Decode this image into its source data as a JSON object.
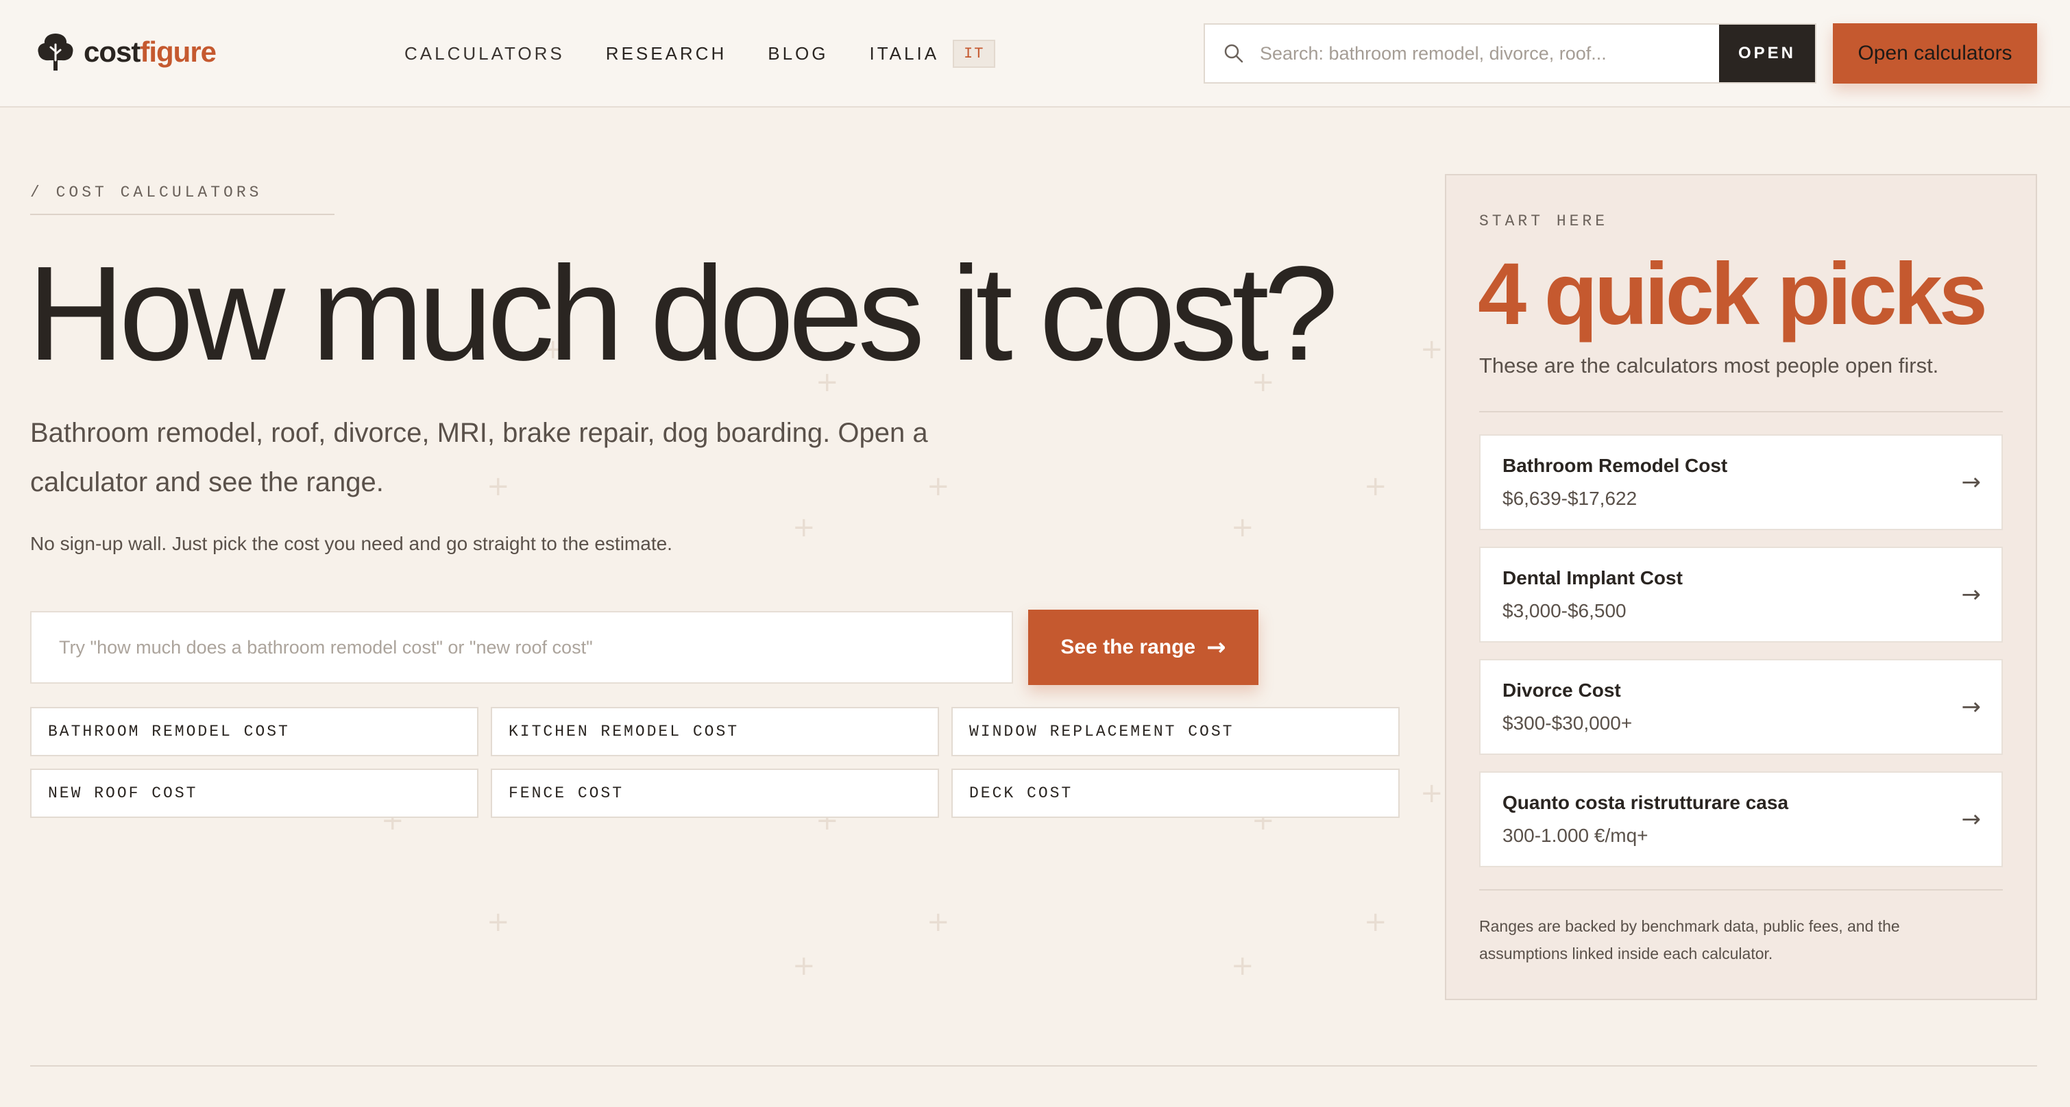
{
  "header": {
    "logo_cost": "cost",
    "logo_figure": "figure",
    "nav": [
      "CALCULATORS",
      "RESEARCH",
      "BLOG",
      "ITALIA"
    ],
    "nav_badge": "IT",
    "search_placeholder": "Search: bathroom remodel, divorce, roof...",
    "open_label": "OPEN",
    "open_calculators_label": "Open calculators"
  },
  "hero": {
    "breadcrumb": "/ COST CALCULATORS",
    "title": "How much does it cost?",
    "subtitle": "Bathroom remodel, roof, divorce, MRI, brake repair, dog boarding. Open a calculator and see the range.",
    "note": "No sign-up wall. Just pick the cost you need and go straight to the estimate.",
    "search_placeholder": "Try \"how much does a bathroom remodel cost\" or \"new roof cost\"",
    "range_button": "See the range",
    "chips": [
      "BATHROOM REMODEL COST",
      "KITCHEN REMODEL COST",
      "WINDOW REPLACEMENT COST",
      "NEW ROOF COST",
      "FENCE COST",
      "DECK COST"
    ]
  },
  "panel": {
    "label": "START HERE",
    "title": "4 quick picks",
    "description": "These are the calculators most people open first.",
    "picks": [
      {
        "name": "Bathroom Remodel Cost",
        "range": "$6,639-$17,622"
      },
      {
        "name": "Dental Implant Cost",
        "range": "$3,000-$6,500"
      },
      {
        "name": "Divorce Cost",
        "range": "$300-$30,000+"
      },
      {
        "name": "Quanto costa ristrutturare casa",
        "range": "300-1.000 €/mq+"
      }
    ],
    "footnote": "Ranges are backed by benchmark data, public fees, and the assumptions linked inside each calculator."
  },
  "colors": {
    "accent": "#c5592f",
    "dark": "#2a2521",
    "background": "#f7f1ea"
  }
}
